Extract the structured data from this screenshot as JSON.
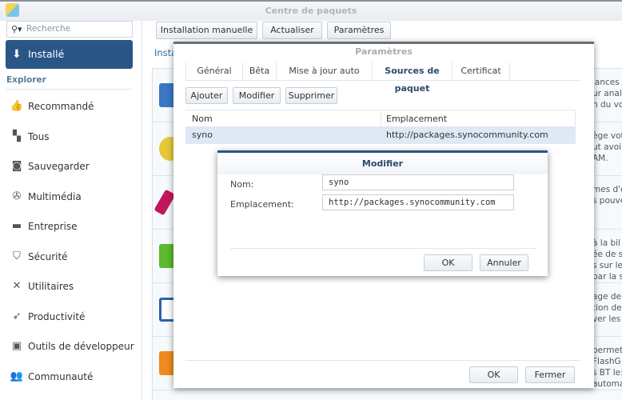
{
  "app": {
    "title": "Centre de paquets"
  },
  "sidebar": {
    "search_placeholder": "Recherche",
    "installed": "Installé",
    "section": "Explorer",
    "items": [
      {
        "label": "Recommandé",
        "icon": "thumbs-up-icon"
      },
      {
        "label": "Tous",
        "icon": "grid-icon"
      },
      {
        "label": "Sauvegarder",
        "icon": "backup-icon"
      },
      {
        "label": "Multimédia",
        "icon": "film-reel-icon"
      },
      {
        "label": "Entreprise",
        "icon": "briefcase-icon"
      },
      {
        "label": "Sécurité",
        "icon": "shield-icon"
      },
      {
        "label": "Utilitaires",
        "icon": "tools-icon"
      },
      {
        "label": "Productivité",
        "icon": "rocket-icon"
      },
      {
        "label": "Outils de développeur",
        "icon": "terminal-icon"
      },
      {
        "label": "Communauté",
        "icon": "people-icon"
      }
    ]
  },
  "toolbar": {
    "manual_install": "Installation manuelle",
    "refresh": "Actualiser",
    "settings": "Paramètres"
  },
  "main": {
    "link": "Insta",
    "rows": [
      {
        "text": "lances\nur anal\nn du vol"
      },
      {
        "text": "ège vot\nut avoir\nAM."
      },
      {
        "text": "mes d'e\ns pouve"
      },
      {
        "text": "à la bil\née de s\ns sur le\npar la s"
      },
      {
        "text": "age de:\ntion des\nver les"
      },
      {
        "text": "permet\nFlashG\ns BT le:\nautomat"
      }
    ]
  },
  "settings_dialog": {
    "title": "Paramètres",
    "tabs": [
      "Général",
      "Bêta",
      "Mise à jour auto",
      "Sources de paquet",
      "Certificat"
    ],
    "active_tab": "Sources de paquet",
    "buttons": {
      "add": "Ajouter",
      "edit": "Modifier",
      "delete": "Supprimer"
    },
    "columns": [
      "Nom",
      "Emplacement"
    ],
    "rows": [
      {
        "name": "syno",
        "location": "http://packages.synocommunity.com"
      }
    ],
    "ok": "OK",
    "close": "Fermer"
  },
  "edit_dialog": {
    "title": "Modifier",
    "name_label": "Nom:",
    "name_value": "syno",
    "location_label": "Emplacement:",
    "location_value": "http://packages.synocommunity.com",
    "ok": "OK",
    "cancel": "Annuler"
  }
}
